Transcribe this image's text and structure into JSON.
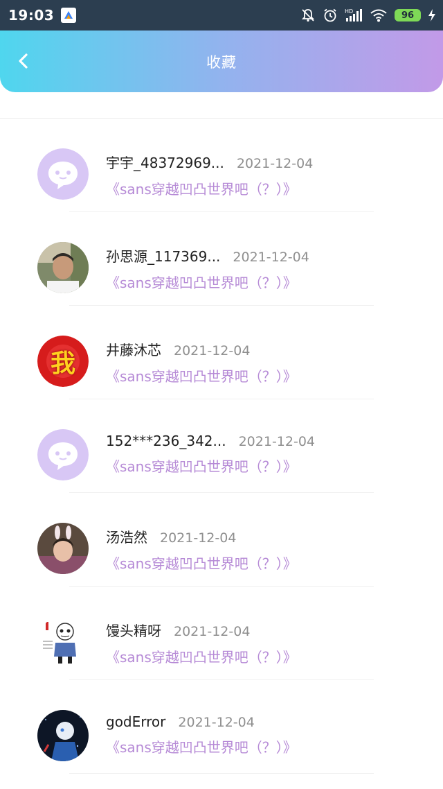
{
  "status_bar": {
    "time": "19:03",
    "battery": "96"
  },
  "header": {
    "title": "收藏"
  },
  "items": [
    {
      "username": "宇宇_48372969...",
      "date": "2021-12-04",
      "collection": "《sans穿越凹凸世界吧（？）》",
      "avatar": "default-chat-avatar"
    },
    {
      "username": "孙思源_117369...",
      "date": "2021-12-04",
      "collection": "《sans穿越凹凸世界吧（？）》",
      "avatar": "photo-boy-avatar"
    },
    {
      "username": "井藤沐芯",
      "date": "2021-12-04",
      "collection": "《sans穿越凹凸世界吧（？）》",
      "avatar": "wo-character-avatar",
      "avatar_text": "我"
    },
    {
      "username": "152***236_342...",
      "date": "2021-12-04",
      "collection": "《sans穿越凹凸世界吧（？）》",
      "avatar": "default-chat-avatar"
    },
    {
      "username": "汤浩然",
      "date": "2021-12-04",
      "collection": "《sans穿越凹凸世界吧（？）》",
      "avatar": "photo-child-bunny-ears-avatar"
    },
    {
      "username": "馒头精呀",
      "date": "2021-12-04",
      "collection": "《sans穿越凹凸世界吧（？）》",
      "avatar": "sans-sketch-avatar"
    },
    {
      "username": "godError",
      "date": "2021-12-04",
      "collection": "《sans穿越凹凸世界吧（？）》",
      "avatar": "dark-anime-avatar"
    }
  ],
  "colors": {
    "header_gradient": [
      "#4fd6ee",
      "#c29ae8"
    ],
    "collection_link": "#b68ad6",
    "default_avatar_bg": "#d8c7f5"
  }
}
